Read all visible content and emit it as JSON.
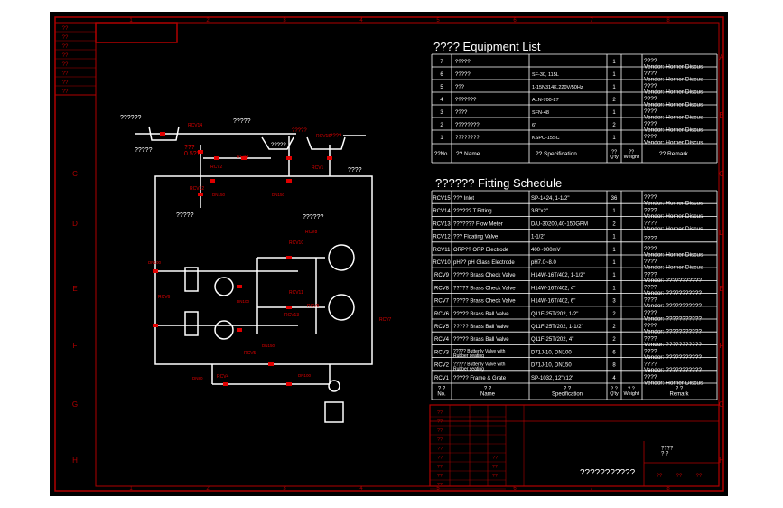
{
  "viewer": {
    "background": "#ffffff",
    "paper": "#000000",
    "frame_color": "#b00000",
    "ink_color": "#ffffff",
    "pipe_color": "#ffffff",
    "tag_color": "#e00000"
  },
  "ruler": {
    "top": [
      "1",
      "2",
      "3",
      "4",
      "5",
      "6",
      "7",
      "8"
    ],
    "bottom": [
      "1",
      "2",
      "3",
      "4",
      "5",
      "6",
      "7",
      "8"
    ],
    "left": [
      "C",
      "D",
      "E",
      "F",
      "G",
      "H"
    ],
    "right": [
      "A",
      "B",
      "C",
      "D",
      "E",
      "F",
      "G",
      "H"
    ]
  },
  "corner_box": [
    "??",
    "??",
    "??",
    "??",
    "??",
    "??",
    "??",
    "??"
  ],
  "equipment": {
    "title": "????  Equipment  List",
    "header": {
      "no": "??No.",
      "name": "?? Name",
      "spec": "?? Specification",
      "qty": "??\nQ'ty",
      "weight": "??\nWeight",
      "remark": "?? Remark"
    },
    "rows": [
      {
        "no": "7",
        "name": "?????",
        "spec": "",
        "qty": "1",
        "remark": "????\nVendor: Horner Discus"
      },
      {
        "no": "6",
        "name": "?????",
        "spec": "SF-30, 115L",
        "qty": "1",
        "remark": "????\nVendor: Horner Discus"
      },
      {
        "no": "5",
        "name": "???",
        "spec": "1-15N314K,220V/50Hz",
        "qty": "1",
        "remark": "????\nVendor: Horner Discus"
      },
      {
        "no": "4",
        "name": "???????",
        "spec": "ALN-700-27",
        "qty": "2",
        "remark": "????\nVendor: Horner Discus"
      },
      {
        "no": "3",
        "name": "????",
        "spec": "SFN-48",
        "qty": "1",
        "remark": "????\nVendor: Horner Discus"
      },
      {
        "no": "2",
        "name": "????????",
        "spec": "6\"",
        "qty": "2",
        "remark": "????\nVendor: Horner Discus"
      },
      {
        "no": "1",
        "name": "????????",
        "spec": "KSPC-15SC",
        "qty": "1",
        "remark": "????\nVendor: Horner Discus"
      }
    ]
  },
  "fitting": {
    "title": "??????    Fitting  Schedule",
    "header": {
      "no": "? ?\nNo.",
      "name": "? ?\nName",
      "spec": "? ?\nSpecification",
      "qty": "? ?\nQ'ty",
      "weight": "? ?\nWeight",
      "remark": "? ?\nRemark"
    },
    "rows": [
      {
        "no": "RCV15",
        "name": "???   Inlet",
        "spec": "SP-1424, 1-1/2\"",
        "qty": "36",
        "remark": "????\nVendor: Horner Discus"
      },
      {
        "no": "RCV14",
        "name": "??????    T.Fitting",
        "spec": "3/8\"x2\"",
        "qty": "1",
        "remark": "????\nVendor: Horner Discus"
      },
      {
        "no": "RCV13",
        "name": "??????? Flow Meter",
        "spec": "D/U-30200,40-150GPM",
        "qty": "2",
        "remark": "????\nVendor: Horner Discus"
      },
      {
        "no": "RCV12",
        "name": "???    Floating Valve",
        "spec": "1-1/2\"",
        "qty": "1",
        "remark": "????"
      },
      {
        "no": "RCV11",
        "name": "ORP??  ORP Electrode",
        "spec": "400~900mV",
        "qty": "1",
        "remark": "????\nVendor: Horner Discus"
      },
      {
        "no": "RCV10",
        "name": "pH??  pH Glass Electrode",
        "spec": "pH7.0~8.0",
        "qty": "1",
        "remark": "????\nVendor: Horner Discus"
      },
      {
        "no": "RCV9",
        "name": "?????  Brass Check Valve",
        "spec": "H14W-16T/402, 1-1/2\"",
        "qty": "1",
        "remark": "????\nVendor: ???????????"
      },
      {
        "no": "RCV8",
        "name": "?????  Brass Check Valve",
        "spec": "H14W-16T/402, 4\"",
        "qty": "1",
        "remark": "????\nVendor: ???????????"
      },
      {
        "no": "RCV7",
        "name": "?????  Brass Check Valve",
        "spec": "H14W-16T/402, 6\"",
        "qty": "3",
        "remark": "????\nVendor: ???????????"
      },
      {
        "no": "RCV6",
        "name": "?????  Brass Ball Valve",
        "spec": "Q11F-25T/202, 1/2\"",
        "qty": "2",
        "remark": "????\nVendor: ???????????"
      },
      {
        "no": "RCV5",
        "name": "?????  Brass Ball Valve",
        "spec": "Q11F-25T/202, 1-1/2\"",
        "qty": "2",
        "remark": "????\nVendor: ???????????"
      },
      {
        "no": "RCV4",
        "name": "?????  Brass Ball Valve",
        "spec": "Q11F-25T/202, 4\"",
        "qty": "2",
        "remark": "????\nVendor: ???????????"
      },
      {
        "no": "RCV3",
        "name": "????? Butterfly Valve with\nRubber seating",
        "spec": "D71J-10, DN100",
        "qty": "6",
        "remark": "????\nVendor: ???????????"
      },
      {
        "no": "RCV2",
        "name": "????? Butterfly Valve with\nRubber seating",
        "spec": "D71J-10, DN150",
        "qty": "8",
        "remark": "????\nVendor: ???????????"
      },
      {
        "no": "RCV1",
        "name": "?????  Frame & Grate",
        "spec": "SP-1032, 12\"x12\"",
        "qty": "4",
        "remark": "????\nVendor: Horner Discus"
      }
    ]
  },
  "title_block": {
    "left_col": [
      "??",
      "??",
      "??",
      "??",
      "??",
      "??",
      "??",
      "??",
      "??"
    ],
    "mid_col": [
      "??",
      "??",
      "??"
    ],
    "center": "???????????",
    "right_top": "????\n? ?",
    "right_bot": [
      "??",
      "??",
      "??"
    ]
  },
  "diagram": {
    "texts": [
      "??????",
      "?????",
      "?????",
      "?????",
      "??????",
      "????",
      "?????",
      "???\n0.5??",
      "?????",
      "????",
      "RCV1",
      "RCV2",
      "RCV3",
      "RCV4",
      "RCV5",
      "RCV6",
      "RCV7",
      "RCV8",
      "RCV9",
      "RCV10",
      "RCV11",
      "RCV12",
      "RCV13",
      "RCV14",
      "RCV15",
      "DN150",
      "DN150",
      "DN150",
      "DN100",
      "DN100",
      "DN80",
      "DN100"
    ]
  }
}
